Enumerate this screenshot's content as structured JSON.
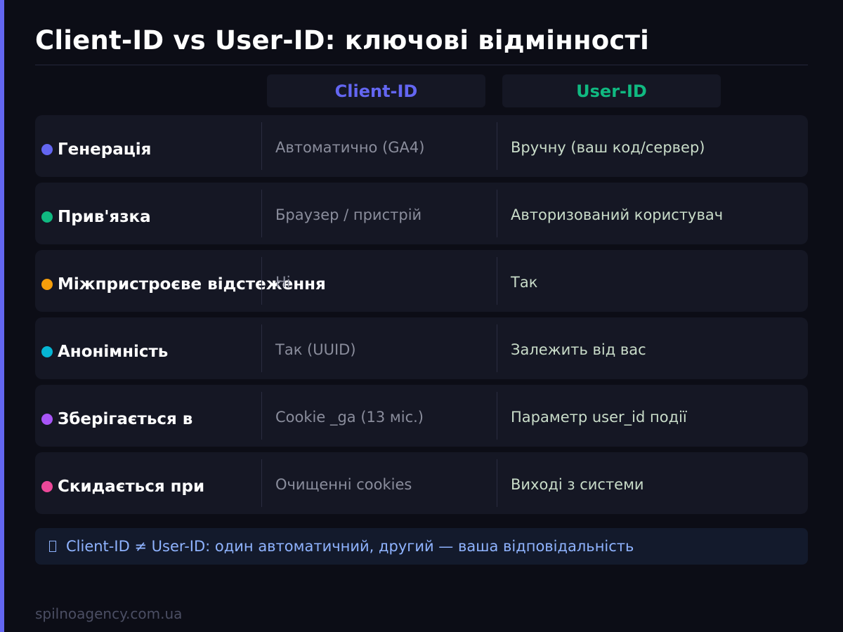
{
  "title": "Client-ID vs User-ID: ключові відмінності",
  "columns": {
    "client": "Client-ID",
    "user": "User-ID"
  },
  "colors": {
    "accent": "#6366f1",
    "client": "#6366f1",
    "user": "#10b981"
  },
  "rows": [
    {
      "label": "Генерація",
      "client": "Автоматично (GA4)",
      "user": "Вручну (ваш код/сервер)",
      "dot_color": "#6366f1"
    },
    {
      "label": "Прив'язка",
      "client": "Браузер / пристрій",
      "user": "Авторизований користувач",
      "dot_color": "#10b981"
    },
    {
      "label": "Міжпристроєве відстеження",
      "client": "Ні",
      "user": "Так",
      "dot_color": "#f59e0b"
    },
    {
      "label": "Анонімність",
      "client": "Так (UUID)",
      "user": "Залежить від вас",
      "dot_color": "#06b6d4"
    },
    {
      "label": "Зберігається в",
      "client": "Cookie _ga (13 міс.)",
      "user": "Параметр user_id події",
      "dot_color": "#a855f7"
    },
    {
      "label": "Скидається при",
      "client": "Очищенні cookies",
      "user": "Виході з системи",
      "dot_color": "#ec4899"
    }
  ],
  "note": {
    "icon": "lightbulb-icon",
    "text": "Client-ID ≠ User-ID: один автоматичний, другий — ваша відповідальність"
  },
  "footer": "spilnoagency.com.ua"
}
